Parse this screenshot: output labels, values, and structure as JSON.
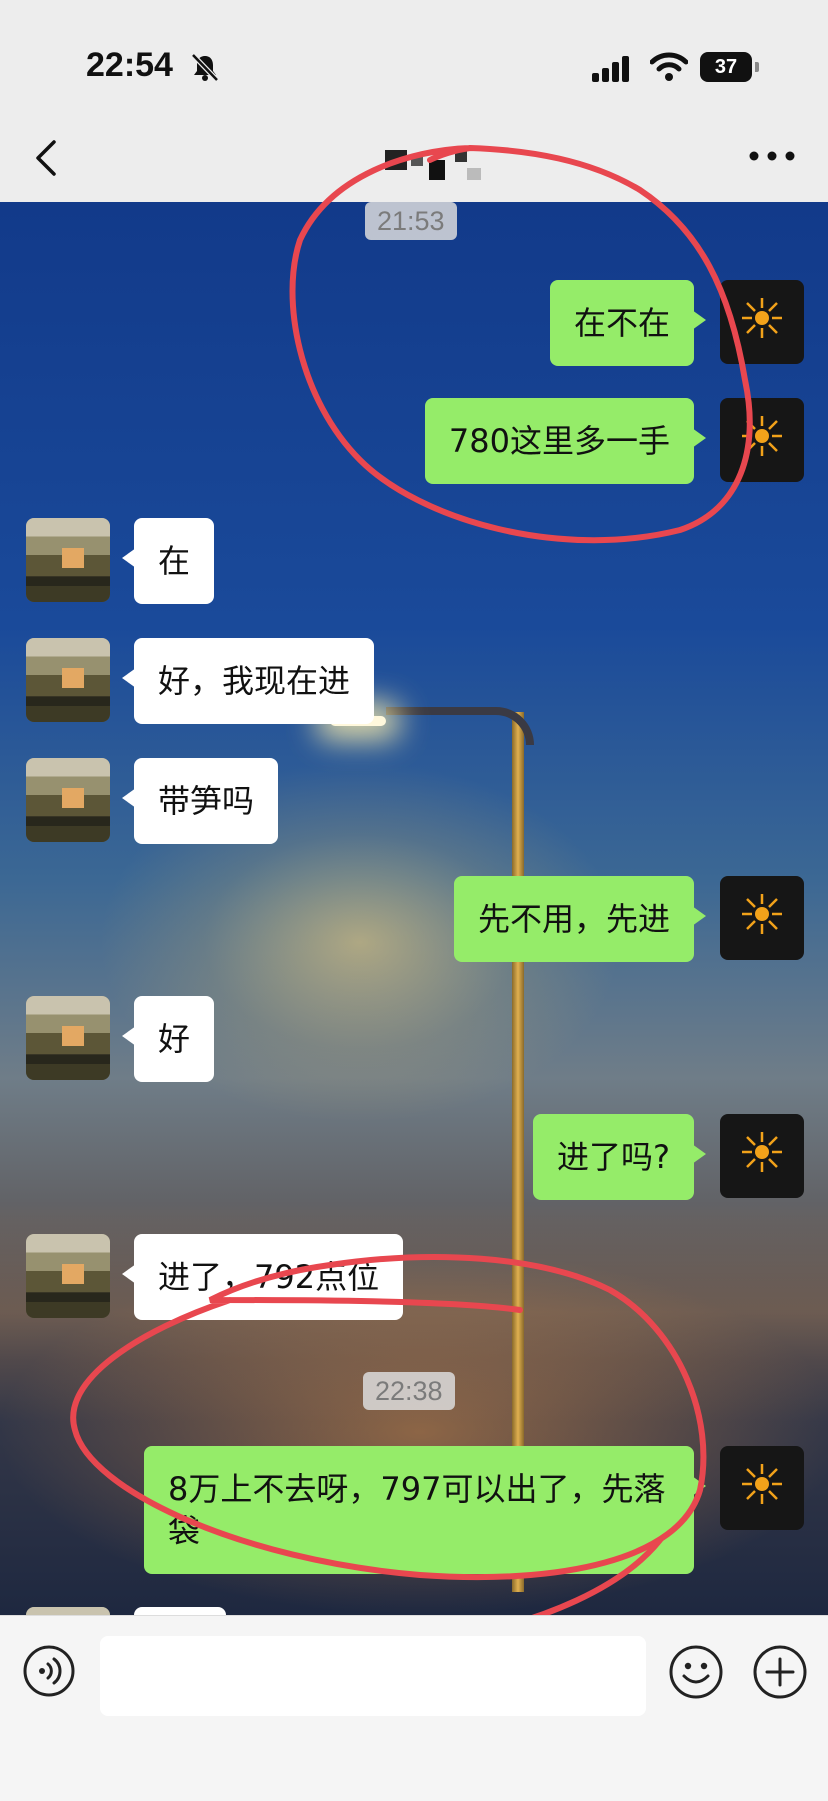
{
  "status": {
    "time": "22:54",
    "battery": "37",
    "icons": [
      "bell-off-icon",
      "signal-icon",
      "wifi-icon",
      "battery-icon"
    ]
  },
  "nav": {
    "back_icon": "chevron-left-icon",
    "more_icon": "more-dots-icon"
  },
  "colors": {
    "me_bubble": "#95ec69",
    "them_bubble": "#ffffff",
    "annotation": "#e8474f"
  },
  "chat": {
    "timestamp_1": "21:53",
    "timestamp_2": "22:38",
    "messages": [
      {
        "from": "me",
        "text": "在不在"
      },
      {
        "from": "me",
        "text": "780这里多一手"
      },
      {
        "from": "them",
        "text": "在"
      },
      {
        "from": "them",
        "text": "好，我现在进"
      },
      {
        "from": "them",
        "text": "带笋吗"
      },
      {
        "from": "me",
        "text": "先不用，先进"
      },
      {
        "from": "them",
        "text": "好"
      },
      {
        "from": "me",
        "text": "进了吗?"
      },
      {
        "from": "them",
        "text": "进了，792点位"
      },
      {
        "from": "me",
        "text": "8万上不去呀，797可以出了，先落袋"
      }
    ]
  },
  "input": {
    "voice_icon": "voice-icon",
    "emoji_icon": "emoji-icon",
    "plus_icon": "plus-icon",
    "value": ""
  }
}
